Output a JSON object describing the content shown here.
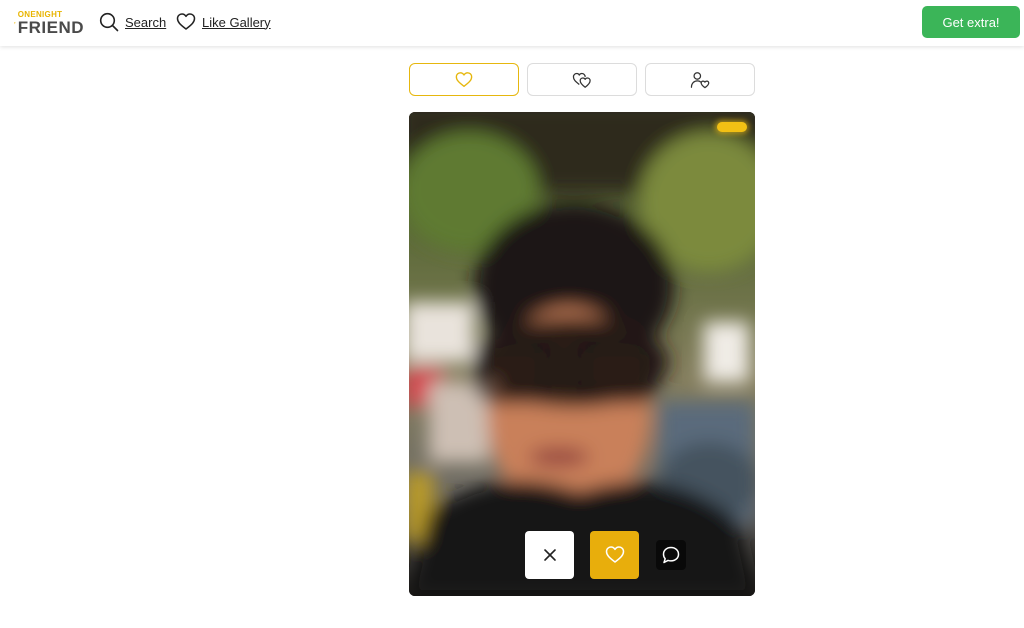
{
  "header": {
    "logo": {
      "top": "ONENIGHT",
      "bottom": "FRIEND"
    },
    "nav": [
      {
        "label": "Search",
        "icon": "search-icon"
      },
      {
        "label": "Like Gallery",
        "icon": "heart-outline-icon"
      }
    ],
    "extra_button": "Get extra!"
  },
  "tabs": [
    {
      "icon": "heart-icon",
      "active": true
    },
    {
      "icon": "double-heart-icon",
      "active": false
    },
    {
      "icon": "user-heart-icon",
      "active": false
    }
  ],
  "card": {
    "photo": "blurred-profile-photo",
    "actions": [
      {
        "icon": "close-icon"
      },
      {
        "icon": "heart-icon"
      },
      {
        "icon": "chat-bubble-icon"
      }
    ]
  },
  "colors": {
    "accent": "#e8ae0c",
    "green": "#3bb558",
    "logo_yellow": "#e8b400"
  }
}
